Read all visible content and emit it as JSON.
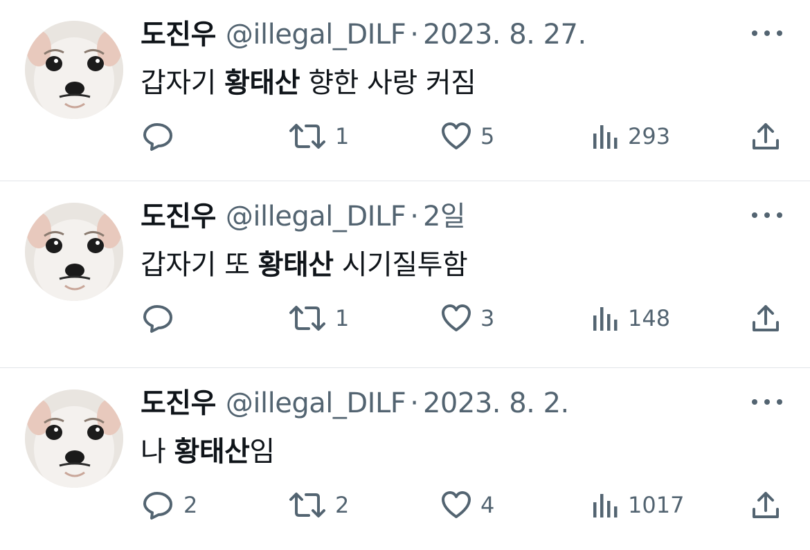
{
  "tweets": [
    {
      "name": "도진우",
      "handle": "@illegal_DILF",
      "separator": "·",
      "date": "2023. 8. 27.",
      "text_before": "갑자기 ",
      "text_bold": "황태산",
      "text_after": " 향한 사랑 커짐",
      "replies": "",
      "retweets": "1",
      "likes": "5",
      "views": "293"
    },
    {
      "name": "도진우",
      "handle": "@illegal_DILF",
      "separator": "·",
      "date": "2일",
      "text_before": "갑자기 또 ",
      "text_bold": "황태산",
      "text_after": " 시기질투함",
      "replies": "",
      "retweets": "1",
      "likes": "3",
      "views": "148"
    },
    {
      "name": "도진우",
      "handle": "@illegal_DILF",
      "separator": "·",
      "date": "2023. 8. 2.",
      "text_before": "나 ",
      "text_bold": "황태산",
      "text_after": "임",
      "replies": "2",
      "retweets": "2",
      "likes": "4",
      "views": "1017"
    }
  ],
  "icons": {
    "reply": "reply-bubble-icon",
    "retweet": "retweet-icon",
    "like": "heart-icon",
    "views": "views-bar-chart-icon",
    "share": "share-icon",
    "more": "more-dots-icon"
  },
  "colors": {
    "text": "#0f1419",
    "secondary": "#536471",
    "divider": "#e1e4e8"
  }
}
